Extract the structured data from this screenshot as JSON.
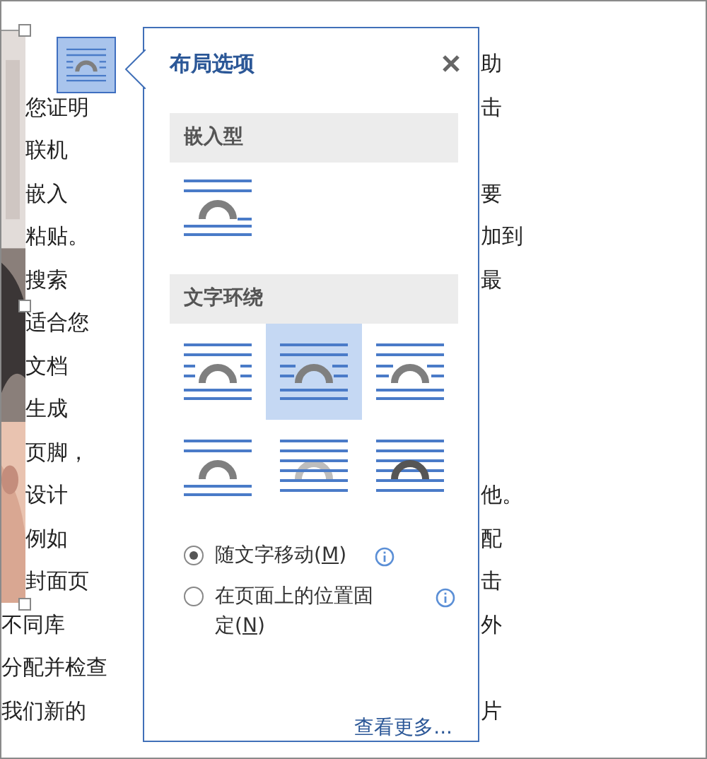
{
  "document": {
    "rows": [
      {
        "right": "助"
      },
      {
        "left": "您证明",
        "right": "击"
      },
      {
        "left": "联机"
      },
      {
        "left": "嵌入",
        "right": "要"
      },
      {
        "left": "粘贴。",
        "right": "加到"
      },
      {
        "left": "搜索",
        "right": "最"
      },
      {
        "left": "适合您"
      },
      {
        "left": "文档"
      },
      {
        "left": "生成"
      },
      {
        "left": "页脚，"
      },
      {
        "left": "设计",
        "right": "他。"
      },
      {
        "left": "例如",
        "right": "配"
      },
      {
        "left": "封面页",
        "right": "击"
      },
      {
        "left": "不同库",
        "right": "外"
      },
      {
        "left": "分配并检查"
      },
      {
        "left": "我们新的",
        "right": "片"
      }
    ]
  },
  "popup": {
    "title": "布局选项",
    "sections": [
      {
        "heading": "嵌入型",
        "options": [
          {
            "kind": "inline",
            "selected": false
          }
        ]
      },
      {
        "heading": "文字环绕",
        "options": [
          {
            "kind": "square",
            "selected": false
          },
          {
            "kind": "tight",
            "selected": true
          },
          {
            "kind": "through",
            "selected": false
          },
          {
            "kind": "top_bottom",
            "selected": false
          },
          {
            "kind": "behind",
            "selected": false
          },
          {
            "kind": "in_front",
            "selected": false
          }
        ]
      }
    ],
    "radios": [
      {
        "label_parts": [
          "随文字移动(",
          "M",
          ")"
        ],
        "checked": true
      },
      {
        "label_parts": [
          "在页面上的位置固定(",
          "N",
          ")"
        ],
        "checked": false
      }
    ],
    "link": "查看更多..."
  }
}
